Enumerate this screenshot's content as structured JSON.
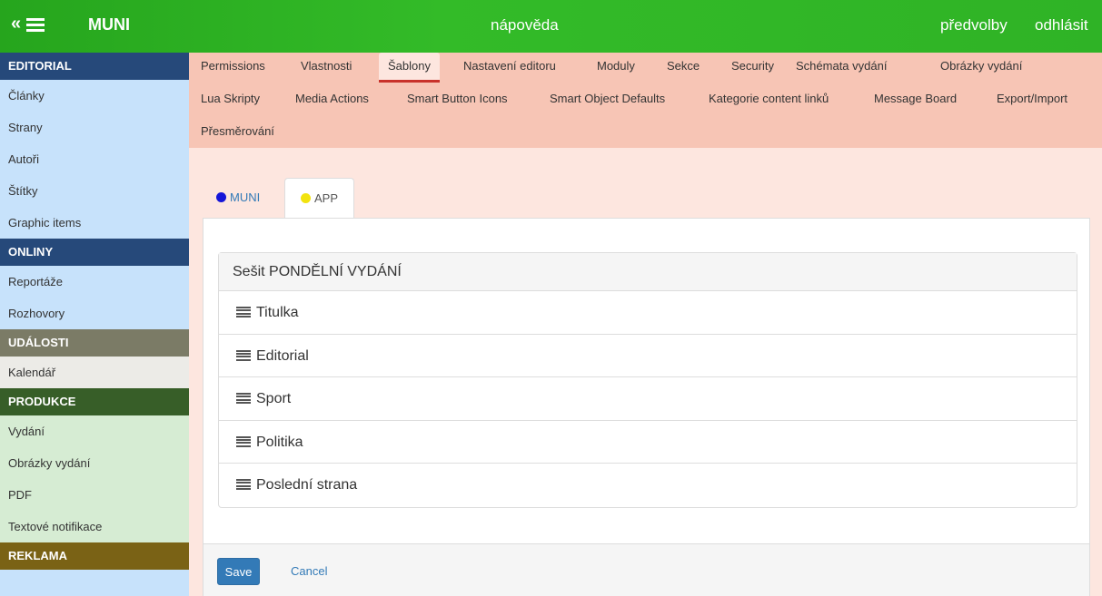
{
  "topbar": {
    "menu_chevron": "«",
    "brand": "MUNI",
    "help": "nápověda",
    "preferences": "předvolby",
    "logout": "odhlásit",
    "color": "#2fb326"
  },
  "sidebar": {
    "editorial": {
      "title": "EDITORIAL",
      "items": [
        "Články",
        "Strany",
        "Autoři",
        "Štítky",
        "Graphic items"
      ]
    },
    "onliny": {
      "title": "ONLINY",
      "items": [
        "Reportáže",
        "Rozhovory"
      ]
    },
    "udalosti": {
      "title": "UDÁLOSTI",
      "items": [
        "Kalendář"
      ]
    },
    "produkce": {
      "title": "PRODUKCE",
      "items": [
        "Vydání",
        "Obrázky vydání",
        "PDF",
        "Textové notifikace"
      ]
    },
    "reklama": {
      "title": "REKLAMA"
    }
  },
  "subnav": {
    "row1": [
      "Permissions",
      "Vlastnosti",
      "Šablony",
      "Nastavení editoru",
      "Moduly",
      "Sekce",
      "Security",
      "Schémata vydání",
      "Obrázky vydání"
    ],
    "row2": [
      "Lua Skripty",
      "Media Actions",
      "Smart Button Icons",
      "Smart Object Defaults",
      "Kategorie content linků",
      "Message Board",
      "Export/Import"
    ],
    "row3": [
      "Přesměrování"
    ],
    "active": "Šablony"
  },
  "content_tabs": [
    {
      "label": "MUNI",
      "dot_color": "#1515d8",
      "active": false
    },
    {
      "label": "APP",
      "dot_color": "#f2e30f",
      "active": true
    }
  ],
  "card": {
    "title": "Sešit PONDĚLNÍ VYDÁNÍ",
    "items": [
      "Titulka",
      "Editorial",
      "Sport",
      "Politika",
      "Poslední strana"
    ]
  },
  "footer": {
    "save": "Save",
    "cancel": "Cancel"
  }
}
